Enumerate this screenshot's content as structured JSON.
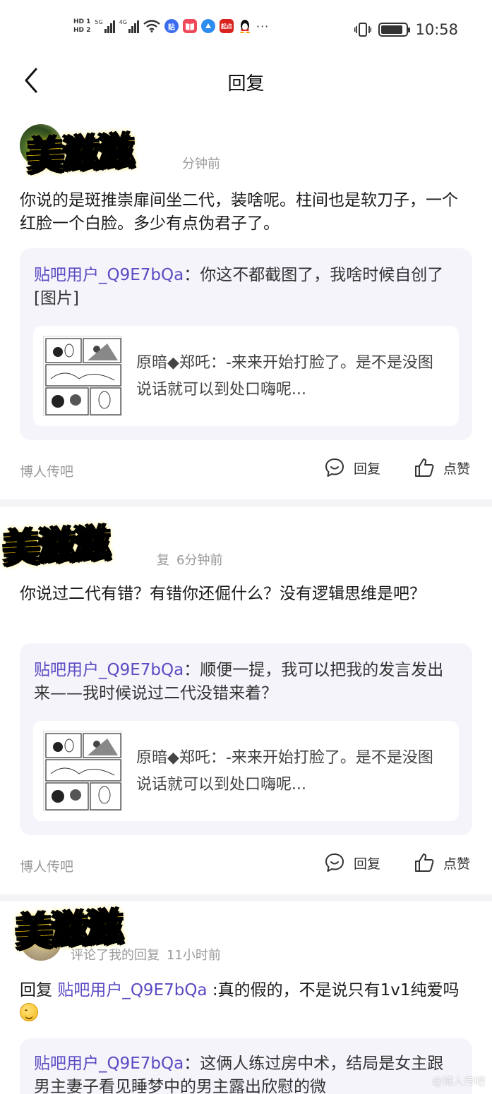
{
  "status_bar": {
    "hd1": "HD 1",
    "hd2": "HD 2",
    "net1": "5G",
    "net2": "4G",
    "time": "10:58",
    "more": "···",
    "app_badge_tieba": "贴",
    "app_badge_qidian": "起点"
  },
  "nav": {
    "title": "回复"
  },
  "sticker_text": "美滋滋",
  "cards": [
    {
      "meta_time": "分钟前",
      "comment": "你说的是斑推崇扉间坐二代，装啥呢。柱间也是软刀子，一个红脸一个白脸。多少有点伪君子了。",
      "quote_user": "贴吧用户_Q9E7bQa",
      "quote_sep": "：",
      "quote_text": "你这不都截图了，我啥时候自创了[图片]",
      "inner_user": "原暗◆郑吒",
      "inner_sep": "：",
      "inner_text": "-来来开始打脸了。是不是没图说话就可以到处口嗨呢...",
      "forum": "博人传吧",
      "reply_label": "回复",
      "like_label": "点赞"
    },
    {
      "meta_action_tail": "复",
      "meta_time": "6分钟前",
      "comment": "你说过二代有错？有错你还倔什么？没有逻辑思维是吧？",
      "quote_user": "贴吧用户_Q9E7bQa",
      "quote_sep": "：",
      "quote_text": "顺便一提，我可以把我的发言发出来——我时候说过二代没错来着？",
      "inner_user": "原暗◆郑吒",
      "inner_sep": "：",
      "inner_text": "-来来开始打脸了。是不是没图说话就可以到处口嗨呢...",
      "forum": "博人传吧",
      "reply_label": "回复",
      "like_label": "点赞"
    },
    {
      "meta_action": "评论了我的回复",
      "meta_time": "11小时前",
      "comment_prefix": "回复 ",
      "comment_mention": "贴吧用户_Q9E7bQa",
      "comment_rest": " :真的假的，不是说只有1v1纯爱吗",
      "quote_user": "贴吧用户_Q9E7bQa",
      "quote_sep": "：",
      "quote_text": "这俩人练过房中术，结局是女主跟男主妻子看见睡梦中的男主露出欣慰的微"
    }
  ],
  "watermark": "@博人传吧",
  "colors": {
    "mention": "#5a4bc2",
    "quote_bg": "#f5f4fb",
    "meta_gray": "#999999"
  }
}
